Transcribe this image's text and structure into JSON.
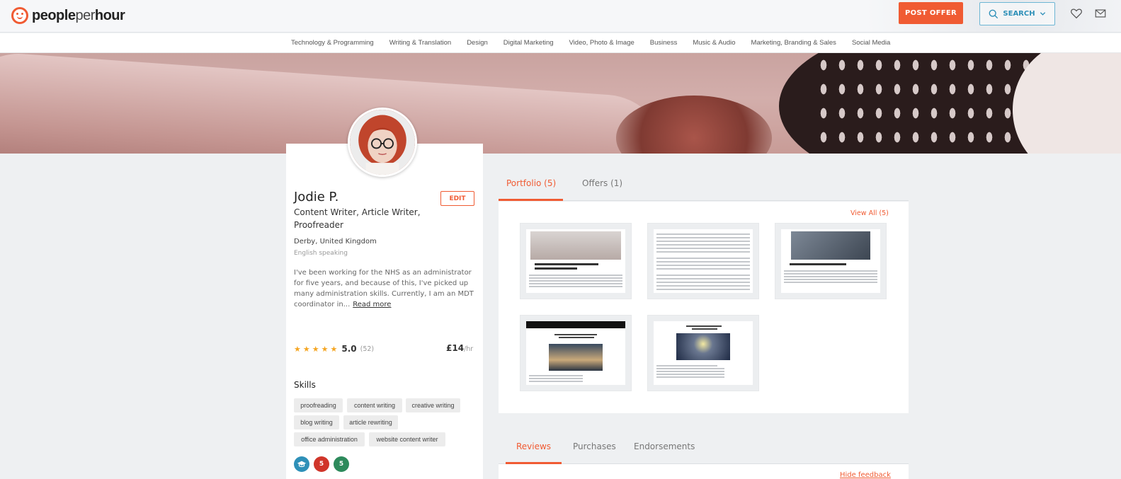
{
  "header": {
    "logo_people": "people",
    "logo_per": "per",
    "logo_hour": "hour",
    "post_offer_label": "POST OFFER",
    "search_label": "SEARCH",
    "accent_color": "#f05b33",
    "search_color": "#2e90b8"
  },
  "categories": [
    "Technology & Programming",
    "Writing & Translation",
    "Design",
    "Digital Marketing",
    "Video, Photo & Image",
    "Business",
    "Music & Audio",
    "Marketing, Branding & Sales",
    "Social Media"
  ],
  "profile": {
    "name": "Jodie P.",
    "edit_label": "EDIT",
    "headline": "Content Writer, Article Writer, Proofreader",
    "location": "Derby, United Kingdom",
    "language": "English speaking",
    "bio": "I've been working for the NHS as an administrator for five years, and because of this, I've picked up many administration skills. Currently, I am an MDT coordinator in...",
    "read_more": "Read more",
    "rating_value": "5.0",
    "rating_count": "(52)",
    "stars": 5,
    "rate_amount": "£14",
    "rate_unit": "/hr",
    "skills_title": "Skills",
    "skills": [
      "proofreading",
      "content writing",
      "creative writing",
      "blog writing",
      "article rewriting",
      "office administration",
      "website content writer"
    ],
    "badges": [
      "graduation-cap-icon",
      "level-5-ribbon-icon",
      "top-5-ribbon-icon"
    ],
    "badge_5": "5",
    "badge_5plus": "5"
  },
  "portfolio": {
    "tab_portfolio": "Portfolio (5)",
    "tab_offers": "Offers (1)",
    "view_all": "View All (5)",
    "items": [
      "portfolio-item-1",
      "portfolio-item-2",
      "portfolio-item-3",
      "portfolio-item-4",
      "portfolio-item-5"
    ]
  },
  "reviews": {
    "tab_reviews": "Reviews",
    "tab_purchases": "Purchases",
    "tab_endorsements": "Endorsements",
    "hide_feedback": "Hide feedback"
  }
}
